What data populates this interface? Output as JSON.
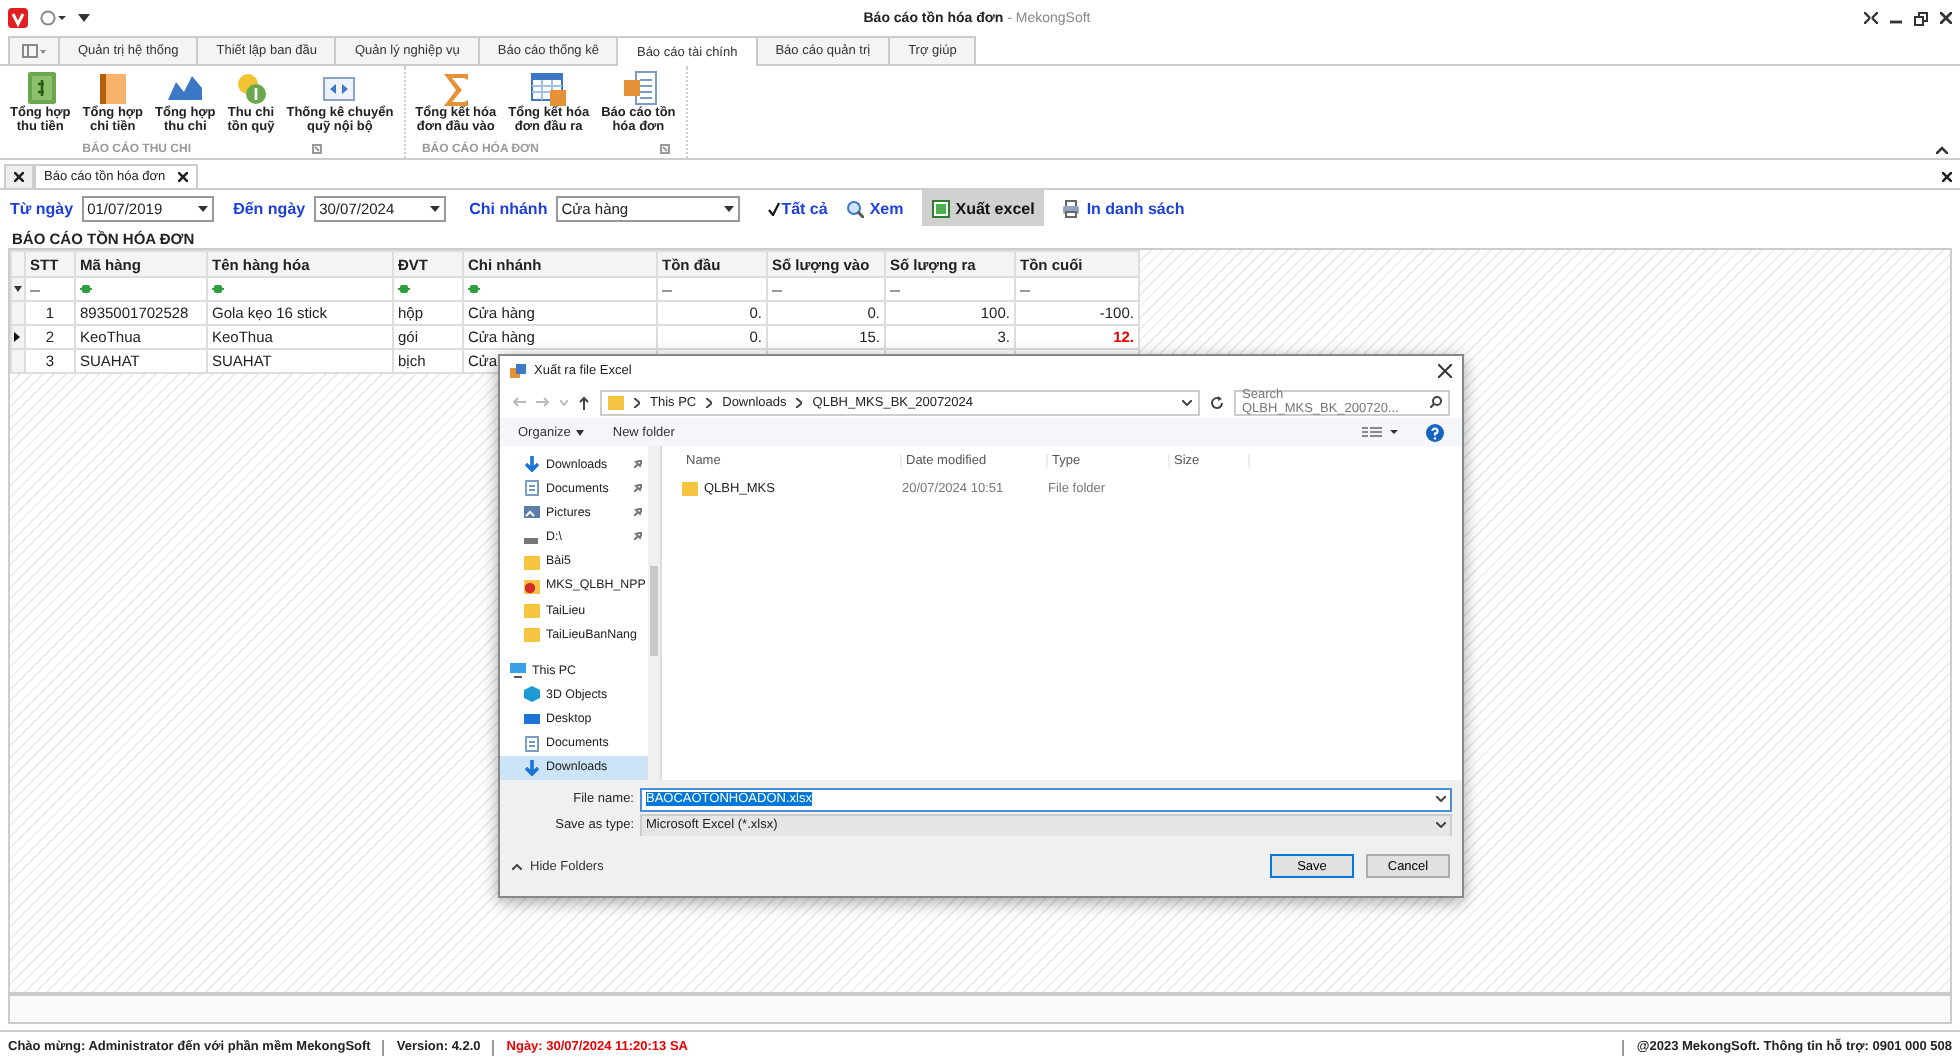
{
  "window": {
    "title": "Báo cáo tồn hóa đơn",
    "app": " - MekongSoft"
  },
  "ribbon": {
    "tabs": [
      {
        "label": "Quản trị hệ thống",
        "selected": false
      },
      {
        "label": "Thiết lập ban đầu",
        "selected": false
      },
      {
        "label": "Quản lý nghiệp vụ",
        "selected": false
      },
      {
        "label": "Báo cáo thống kê",
        "selected": false
      },
      {
        "label": "Báo cáo tài chính",
        "selected": true
      },
      {
        "label": "Báo cáo quản trị",
        "selected": false
      },
      {
        "label": "Trợ giúp",
        "selected": false
      }
    ],
    "groups": [
      {
        "label": "BÁO CÁO THU CHI",
        "buttons": [
          {
            "label": "Tổng hợp\nthu tiền"
          },
          {
            "label": "Tổng hợp\nchi tiền"
          },
          {
            "label": "Tổng hợp\nthu chi"
          },
          {
            "label": "Thu chi\ntồn quỹ"
          },
          {
            "label": "Thống kê chuyển\nquỹ nội bộ"
          }
        ]
      },
      {
        "label": "BÁO CÁO HÓA ĐƠN",
        "buttons": [
          {
            "label": "Tổng kết hóa\nđơn đầu vào"
          },
          {
            "label": "Tổng kết hóa\nđơn đầu ra"
          },
          {
            "label": "Báo cáo tồn\nhóa đơn"
          }
        ]
      }
    ]
  },
  "doc_tabs": [
    {
      "label": "Báo cáo tồn hóa đơn",
      "selected": true
    }
  ],
  "filter": {
    "from_label": "Từ ngày",
    "from": "01/07/2019",
    "to_label": "Đến ngày",
    "to": "30/07/2024",
    "branch_label": "Chi nhánh",
    "branch": "Cửa hàng",
    "all": {
      "label": "Tất cả",
      "checked": true
    },
    "buttons": [
      {
        "label": "Xem",
        "pressed": false
      },
      {
        "label": "Xuất excel",
        "pressed": true
      },
      {
        "label": "In danh sách",
        "pressed": false
      }
    ]
  },
  "report": {
    "title": "BÁO CÁO TỒN HÓA ĐƠN",
    "columns": [
      "STT",
      "Mã hàng",
      "Tên hàng hóa",
      "ĐVT",
      "Chi nhánh",
      "Tồn đầu",
      "Số lượng vào",
      "Số lượng ra",
      "Tồn cuối"
    ],
    "rows": [
      {
        "current": false,
        "alert_last": false,
        "cells": [
          "1",
          "8935001702528",
          "Gola kẹo 16 stick",
          "hộp",
          "Cửa hàng",
          "0.",
          "0.",
          "100.",
          "-100."
        ]
      },
      {
        "current": true,
        "alert_last": true,
        "cells": [
          "2",
          "KeoThua",
          "KeoThua",
          "gói",
          "Cửa hàng",
          "0.",
          "15.",
          "3.",
          "12."
        ]
      },
      {
        "current": false,
        "alert_last": false,
        "cells": [
          "3",
          "SUAHAT",
          "SUAHAT",
          "bịch",
          "Cửa"
        ]
      }
    ]
  },
  "dialog": {
    "title": "Xuất ra file Excel",
    "path": [
      "This PC",
      "Downloads",
      "QLBH_MKS_BK_20072024"
    ],
    "search_placeholder": "Search QLBH_MKS_BK_200720...",
    "toolbar": [
      {
        "label": "Organize",
        "menu": true
      },
      {
        "label": "New folder",
        "menu": false
      }
    ],
    "quick_access": [
      {
        "label": "Downloads",
        "kind": "download",
        "pinned": true,
        "selected": false
      },
      {
        "label": "Documents",
        "kind": "document",
        "pinned": true,
        "selected": false
      },
      {
        "label": "Pictures",
        "kind": "pictures",
        "pinned": true,
        "selected": false
      },
      {
        "label": "D:\\",
        "kind": "drive",
        "pinned": true,
        "selected": false
      },
      {
        "label": "Bài5",
        "kind": "folder",
        "pinned": false,
        "selected": false
      },
      {
        "label": "MKS_QLBH_NPP",
        "kind": "app",
        "pinned": false,
        "selected": false
      },
      {
        "label": "TaiLieu",
        "kind": "folder",
        "pinned": false,
        "selected": false
      },
      {
        "label": "TaiLieuBanNang",
        "kind": "folder",
        "pinned": false,
        "selected": false
      }
    ],
    "this_pc": {
      "label": "This PC",
      "kind": "pc",
      "children": [
        {
          "label": "3D Objects",
          "kind": "cube",
          "selected": false
        },
        {
          "label": "Desktop",
          "kind": "desktop",
          "selected": false
        },
        {
          "label": "Documents",
          "kind": "document",
          "selected": false
        },
        {
          "label": "Downloads",
          "kind": "download",
          "selected": true
        }
      ]
    },
    "columns": [
      "Name",
      "Date modified",
      "Type",
      "Size"
    ],
    "files": [
      {
        "name": "QLBH_MKS",
        "modified": "20/07/2024 10:51",
        "type": "File folder"
      }
    ],
    "file_name_label": "File name:",
    "file_name": "BAOCAOTONHOADON.xlsx",
    "type_label": "Save as type:",
    "type": "Microsoft Excel (*.xlsx)",
    "hide_folders": "Hide Folders",
    "buttons": [
      {
        "label": "Save",
        "default": true
      },
      {
        "label": "Cancel",
        "default": false
      }
    ]
  },
  "status_bar": [
    {
      "text": "Chào mừng: Administrator đến với phần mềm MekongSoft",
      "alert": false
    },
    {
      "text": "Version: 4.2.0",
      "alert": false
    },
    {
      "text": "Ngày: 30/07/2024 11:20:13 SA",
      "alert": true
    }
  ],
  "status_right": "@2023 MekongSoft. Thông tin hỗ trợ: 0901 000 508"
}
